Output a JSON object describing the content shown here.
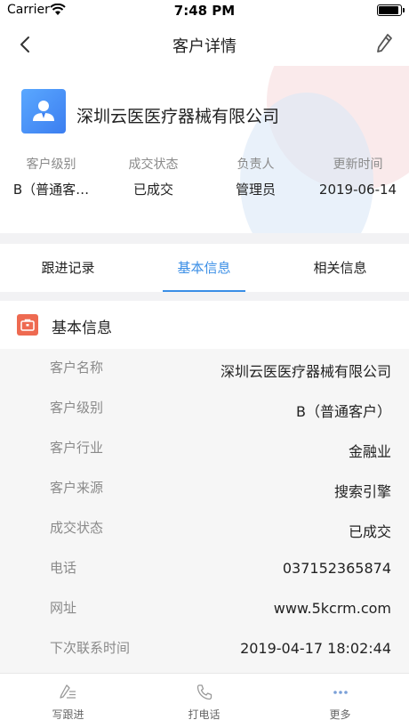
{
  "status_bar": {
    "carrier": "Carrier",
    "time": "7:48 PM"
  },
  "nav": {
    "title": "客户详情"
  },
  "header": {
    "company_name": "深圳云医医疗器械有限公司",
    "summary": [
      {
        "label": "客户级别",
        "value": "B（普通客…"
      },
      {
        "label": "成交状态",
        "value": "已成交"
      },
      {
        "label": "负责人",
        "value": "管理员"
      },
      {
        "label": "更新时间",
        "value": "2019-06-14"
      }
    ]
  },
  "tabs": [
    {
      "label": "跟进记录",
      "active": false
    },
    {
      "label": "基本信息",
      "active": true
    },
    {
      "label": "相关信息",
      "active": false
    }
  ],
  "section": {
    "title": "基本信息"
  },
  "info_rows": [
    {
      "label": "客户名称",
      "value": "深圳云医医疗器械有限公司"
    },
    {
      "label": "客户级别",
      "value": "B（普通客户）"
    },
    {
      "label": "客户行业",
      "value": "金融业"
    },
    {
      "label": "客户来源",
      "value": "搜索引擎"
    },
    {
      "label": "成交状态",
      "value": "已成交"
    },
    {
      "label": "电话",
      "value": "037152365874"
    },
    {
      "label": "网址",
      "value": "www.5kcrm.com"
    },
    {
      "label": "下次联系时间",
      "value": "2019-04-17 18:02:44"
    }
  ],
  "toolbar": [
    {
      "label": "写跟进",
      "icon": "pencil-list-icon"
    },
    {
      "label": "打电话",
      "icon": "phone-icon"
    },
    {
      "label": "更多",
      "icon": "more-dots-icon"
    }
  ],
  "colors": {
    "accent": "#3a8ee6",
    "section_icon": "#ee6a51",
    "avatar": "#4a94f8"
  }
}
